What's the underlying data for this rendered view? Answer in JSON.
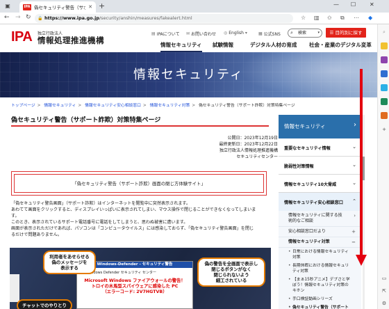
{
  "browser": {
    "tab_favicon": "IPA",
    "tab_title": "偽セキュリティ警告（サポート詐欺）",
    "url_host": "https://www.ipa.go.jp",
    "url_path": "/security/anshin/measures/fakealert.html"
  },
  "site": {
    "logo_mark": "IPA",
    "logo_sub": "独立行政法人",
    "logo_name": "情報処理推進機構",
    "header_links": [
      "IPAについて",
      "お問い合わせ",
      "English",
      "公式SNS"
    ],
    "search_label": "検索",
    "goal_button": "目的別に探す",
    "main_nav": [
      "情報セキュリティ",
      "試験情報",
      "デジタル人材の育成",
      "社会・産業のデジタル変革"
    ],
    "hero_title": "情報セキュリティ"
  },
  "breadcrumb": {
    "items": [
      "トップページ",
      "情報セキュリティ",
      "情報セキュリティ安心相談窓口",
      "情報セキュリティ対策"
    ],
    "current": "偽セキュリティ警告（サポート詐欺）対策特集ページ"
  },
  "article": {
    "title": "偽セキュリティ警告（サポート詐欺）対策特集ページ",
    "published": "公開日：2023年12月19日",
    "updated": "最終更新日：2023年12月22日",
    "org": "独立行政法人情報処理推進機構",
    "dept": "セキュリティセンター",
    "link_box": "「偽セキュリティ警告（サポート詐欺）画面の閉じ方体験サイト」",
    "paragraphs": [
      "「偽セキュリティ警告画面」（サポート詐欺）はインターネットを閲覧中に突然表示されます。",
      "あわてて画面をクリックすると、ディスプレイいっぱいに表示されてしまい、マウス操作で閉じることができなくなってしまいま",
      "す。",
      "このとき、表示されているサポート電話番号に電話をしてしまうと、思わぬ被害に遭います。",
      "画面が表示されただけであれば、パソコンは「コンピュータウイルス」には感染しておらず、「偽セキュリティ警告画面」を閉じ",
      "るだけで問題ありません。"
    ]
  },
  "illustration": {
    "bubble_1": [
      "利用者をあせらせる",
      "偽のメッセージを",
      "表示する"
    ],
    "bubble_2": [
      "偽の警告を全画面で表示し",
      "閉じるボタンがなく",
      "閉じられないよう",
      "細工されている"
    ],
    "bubble_3": "チャットでのやりとり",
    "popup_title": "Windows-Defender - セキュリティ警告",
    "popup_sub": "Windows Defender セキュリティ センター",
    "popup_red": [
      "Microsoft Windows ファイアウォールの警告！",
      "トロイの木馬型スパイウェアに感染した PC",
      "（エラーコード: 2V7HGTVB）"
    ]
  },
  "sidebar": {
    "head": "情報セキュリティ",
    "items": [
      "重要なセキュリティ情報",
      "脆弱性対策情報",
      "情報セキュリティ10大脅威",
      "情報セキュリティ安心相談窓口"
    ],
    "sub_items": [
      "情報セキュリティに関する技術的なご相談",
      "安心相談窓口だより",
      "情報セキュリティ対策"
    ],
    "leaves": [
      "日常における情報セキュリティ対策",
      "長期休暇における情報セキュリティ対策",
      "【まぁ15秒アニメ】デブさと学ぼう！情報セキュリティ対策のキホン",
      "手口検証動画シリーズ",
      "偽セキュリティ警告（サポート詐欺）対策特集ページ"
    ]
  },
  "colors": {
    "accent_red": "#e2231a",
    "nav_blue": "#2a6fab",
    "arrow": "#e3000f"
  }
}
